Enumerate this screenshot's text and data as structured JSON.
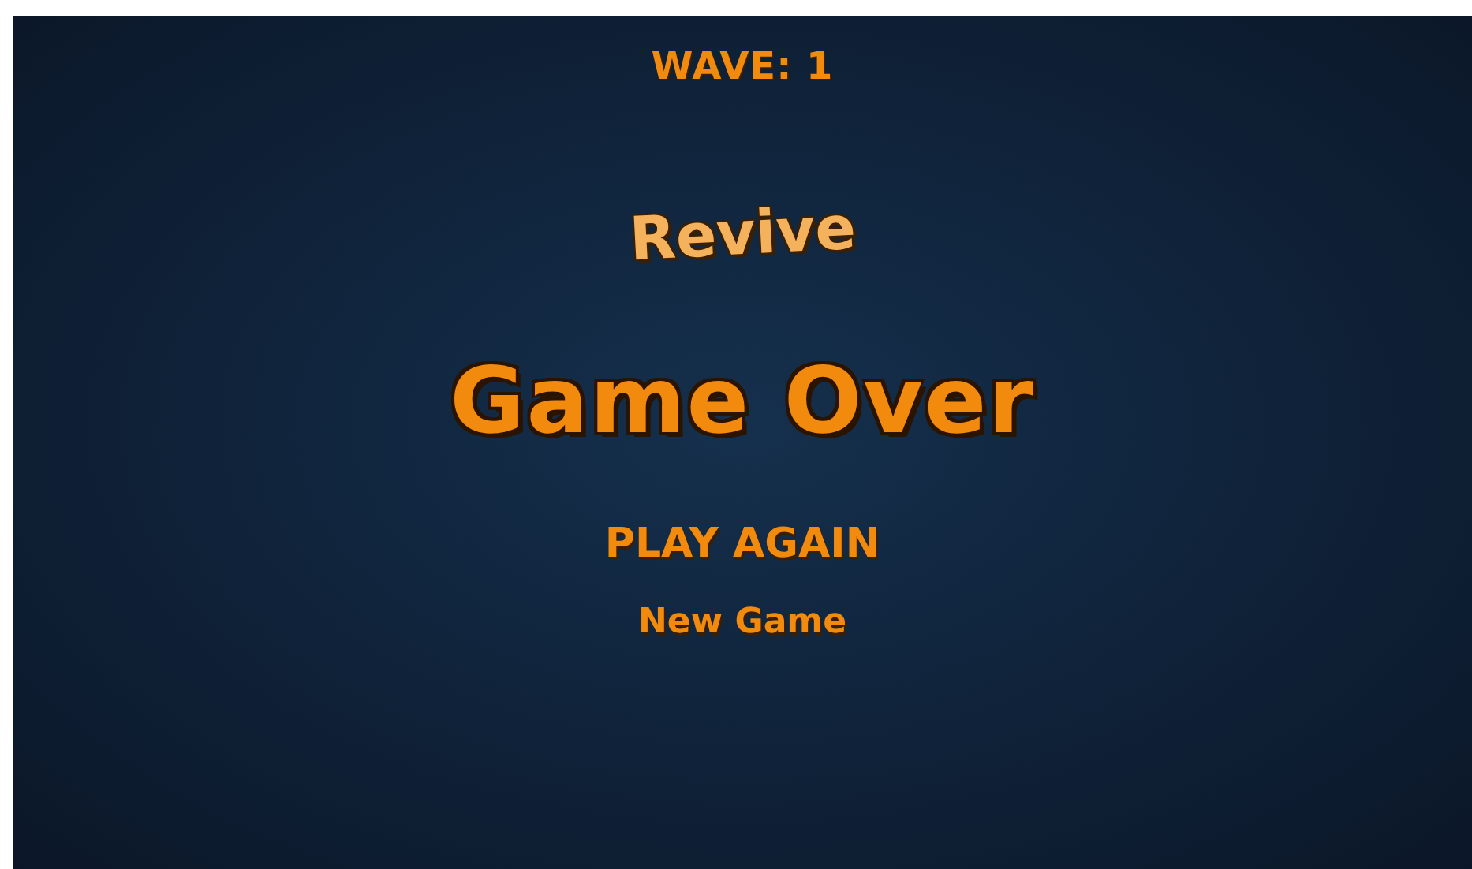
{
  "hud": {
    "wave": "WAVE: 1"
  },
  "menu": {
    "revive": "Revive",
    "title": "Game Over",
    "play_again": "PLAY AGAIN",
    "new_game": "New Game"
  }
}
